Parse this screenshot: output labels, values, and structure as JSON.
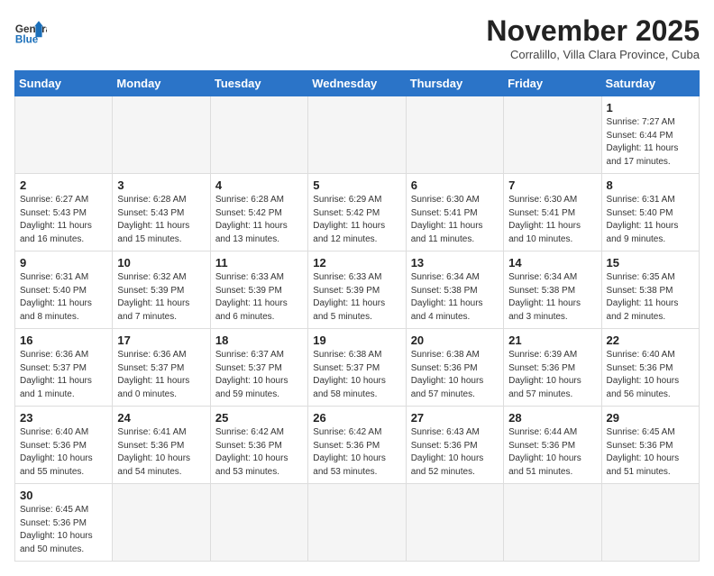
{
  "header": {
    "logo_general": "General",
    "logo_blue": "Blue",
    "month_title": "November 2025",
    "location": "Corralillo, Villa Clara Province, Cuba"
  },
  "days_of_week": [
    "Sunday",
    "Monday",
    "Tuesday",
    "Wednesday",
    "Thursday",
    "Friday",
    "Saturday"
  ],
  "weeks": [
    [
      {
        "day": null,
        "info": null
      },
      {
        "day": null,
        "info": null
      },
      {
        "day": null,
        "info": null
      },
      {
        "day": null,
        "info": null
      },
      {
        "day": null,
        "info": null
      },
      {
        "day": null,
        "info": null
      },
      {
        "day": "1",
        "info": "Sunrise: 7:27 AM\nSunset: 6:44 PM\nDaylight: 11 hours\nand 17 minutes."
      }
    ],
    [
      {
        "day": "2",
        "info": "Sunrise: 6:27 AM\nSunset: 5:43 PM\nDaylight: 11 hours\nand 16 minutes."
      },
      {
        "day": "3",
        "info": "Sunrise: 6:28 AM\nSunset: 5:43 PM\nDaylight: 11 hours\nand 15 minutes."
      },
      {
        "day": "4",
        "info": "Sunrise: 6:28 AM\nSunset: 5:42 PM\nDaylight: 11 hours\nand 13 minutes."
      },
      {
        "day": "5",
        "info": "Sunrise: 6:29 AM\nSunset: 5:42 PM\nDaylight: 11 hours\nand 12 minutes."
      },
      {
        "day": "6",
        "info": "Sunrise: 6:30 AM\nSunset: 5:41 PM\nDaylight: 11 hours\nand 11 minutes."
      },
      {
        "day": "7",
        "info": "Sunrise: 6:30 AM\nSunset: 5:41 PM\nDaylight: 11 hours\nand 10 minutes."
      },
      {
        "day": "8",
        "info": "Sunrise: 6:31 AM\nSunset: 5:40 PM\nDaylight: 11 hours\nand 9 minutes."
      }
    ],
    [
      {
        "day": "9",
        "info": "Sunrise: 6:31 AM\nSunset: 5:40 PM\nDaylight: 11 hours\nand 8 minutes."
      },
      {
        "day": "10",
        "info": "Sunrise: 6:32 AM\nSunset: 5:39 PM\nDaylight: 11 hours\nand 7 minutes."
      },
      {
        "day": "11",
        "info": "Sunrise: 6:33 AM\nSunset: 5:39 PM\nDaylight: 11 hours\nand 6 minutes."
      },
      {
        "day": "12",
        "info": "Sunrise: 6:33 AM\nSunset: 5:39 PM\nDaylight: 11 hours\nand 5 minutes."
      },
      {
        "day": "13",
        "info": "Sunrise: 6:34 AM\nSunset: 5:38 PM\nDaylight: 11 hours\nand 4 minutes."
      },
      {
        "day": "14",
        "info": "Sunrise: 6:34 AM\nSunset: 5:38 PM\nDaylight: 11 hours\nand 3 minutes."
      },
      {
        "day": "15",
        "info": "Sunrise: 6:35 AM\nSunset: 5:38 PM\nDaylight: 11 hours\nand 2 minutes."
      }
    ],
    [
      {
        "day": "16",
        "info": "Sunrise: 6:36 AM\nSunset: 5:37 PM\nDaylight: 11 hours\nand 1 minute."
      },
      {
        "day": "17",
        "info": "Sunrise: 6:36 AM\nSunset: 5:37 PM\nDaylight: 11 hours\nand 0 minutes."
      },
      {
        "day": "18",
        "info": "Sunrise: 6:37 AM\nSunset: 5:37 PM\nDaylight: 10 hours\nand 59 minutes."
      },
      {
        "day": "19",
        "info": "Sunrise: 6:38 AM\nSunset: 5:37 PM\nDaylight: 10 hours\nand 58 minutes."
      },
      {
        "day": "20",
        "info": "Sunrise: 6:38 AM\nSunset: 5:36 PM\nDaylight: 10 hours\nand 57 minutes."
      },
      {
        "day": "21",
        "info": "Sunrise: 6:39 AM\nSunset: 5:36 PM\nDaylight: 10 hours\nand 57 minutes."
      },
      {
        "day": "22",
        "info": "Sunrise: 6:40 AM\nSunset: 5:36 PM\nDaylight: 10 hours\nand 56 minutes."
      }
    ],
    [
      {
        "day": "23",
        "info": "Sunrise: 6:40 AM\nSunset: 5:36 PM\nDaylight: 10 hours\nand 55 minutes."
      },
      {
        "day": "24",
        "info": "Sunrise: 6:41 AM\nSunset: 5:36 PM\nDaylight: 10 hours\nand 54 minutes."
      },
      {
        "day": "25",
        "info": "Sunrise: 6:42 AM\nSunset: 5:36 PM\nDaylight: 10 hours\nand 53 minutes."
      },
      {
        "day": "26",
        "info": "Sunrise: 6:42 AM\nSunset: 5:36 PM\nDaylight: 10 hours\nand 53 minutes."
      },
      {
        "day": "27",
        "info": "Sunrise: 6:43 AM\nSunset: 5:36 PM\nDaylight: 10 hours\nand 52 minutes."
      },
      {
        "day": "28",
        "info": "Sunrise: 6:44 AM\nSunset: 5:36 PM\nDaylight: 10 hours\nand 51 minutes."
      },
      {
        "day": "29",
        "info": "Sunrise: 6:45 AM\nSunset: 5:36 PM\nDaylight: 10 hours\nand 51 minutes."
      }
    ],
    [
      {
        "day": "30",
        "info": "Sunrise: 6:45 AM\nSunset: 5:36 PM\nDaylight: 10 hours\nand 50 minutes."
      },
      {
        "day": null,
        "info": null
      },
      {
        "day": null,
        "info": null
      },
      {
        "day": null,
        "info": null
      },
      {
        "day": null,
        "info": null
      },
      {
        "day": null,
        "info": null
      },
      {
        "day": null,
        "info": null
      }
    ]
  ]
}
